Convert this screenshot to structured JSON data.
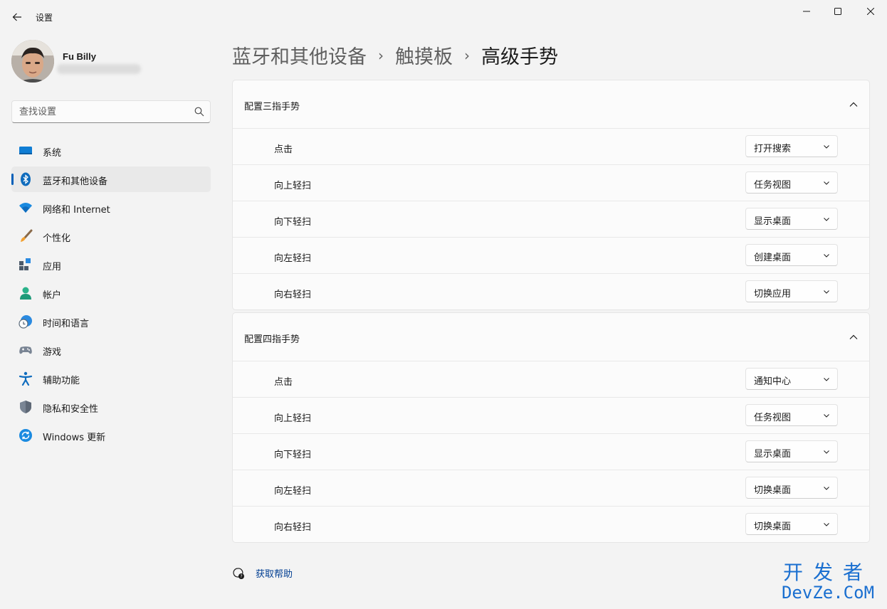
{
  "window": {
    "title": "设置"
  },
  "user": {
    "name": "Fu Billy"
  },
  "search": {
    "placeholder": "查找设置"
  },
  "nav": {
    "items": [
      {
        "label": "系统",
        "icon": "monitor-icon",
        "active": false
      },
      {
        "label": "蓝牙和其他设备",
        "icon": "bluetooth-icon",
        "active": true
      },
      {
        "label": "网络和 Internet",
        "icon": "wifi-icon",
        "active": false
      },
      {
        "label": "个性化",
        "icon": "brush-icon",
        "active": false
      },
      {
        "label": "应用",
        "icon": "apps-icon",
        "active": false
      },
      {
        "label": "帐户",
        "icon": "account-icon",
        "active": false
      },
      {
        "label": "时间和语言",
        "icon": "globe-clock-icon",
        "active": false
      },
      {
        "label": "游戏",
        "icon": "gamepad-icon",
        "active": false
      },
      {
        "label": "辅助功能",
        "icon": "accessibility-icon",
        "active": false
      },
      {
        "label": "隐私和安全性",
        "icon": "shield-icon",
        "active": false
      },
      {
        "label": "Windows 更新",
        "icon": "update-icon",
        "active": false
      }
    ]
  },
  "breadcrumb": {
    "level1": "蓝牙和其他设备",
    "level2": "触摸板",
    "current": "高级手势",
    "separator": "›"
  },
  "sections": [
    {
      "title": "配置三指手势",
      "rows": [
        {
          "label": "点击",
          "value": "打开搜索"
        },
        {
          "label": "向上轻扫",
          "value": "任务视图"
        },
        {
          "label": "向下轻扫",
          "value": "显示桌面"
        },
        {
          "label": "向左轻扫",
          "value": "创建桌面"
        },
        {
          "label": "向右轻扫",
          "value": "切换应用"
        }
      ]
    },
    {
      "title": "配置四指手势",
      "rows": [
        {
          "label": "点击",
          "value": "通知中心"
        },
        {
          "label": "向上轻扫",
          "value": "任务视图"
        },
        {
          "label": "向下轻扫",
          "value": "显示桌面"
        },
        {
          "label": "向左轻扫",
          "value": "切换桌面"
        },
        {
          "label": "向右轻扫",
          "value": "切换桌面"
        }
      ]
    }
  ],
  "help": {
    "label": "获取帮助"
  },
  "watermark": {
    "line1": "开发者",
    "line2": "DevZe.CoM"
  },
  "colors": {
    "accent": "#005fb8",
    "link": "#003e92",
    "watermark": "#1a6fd0"
  }
}
